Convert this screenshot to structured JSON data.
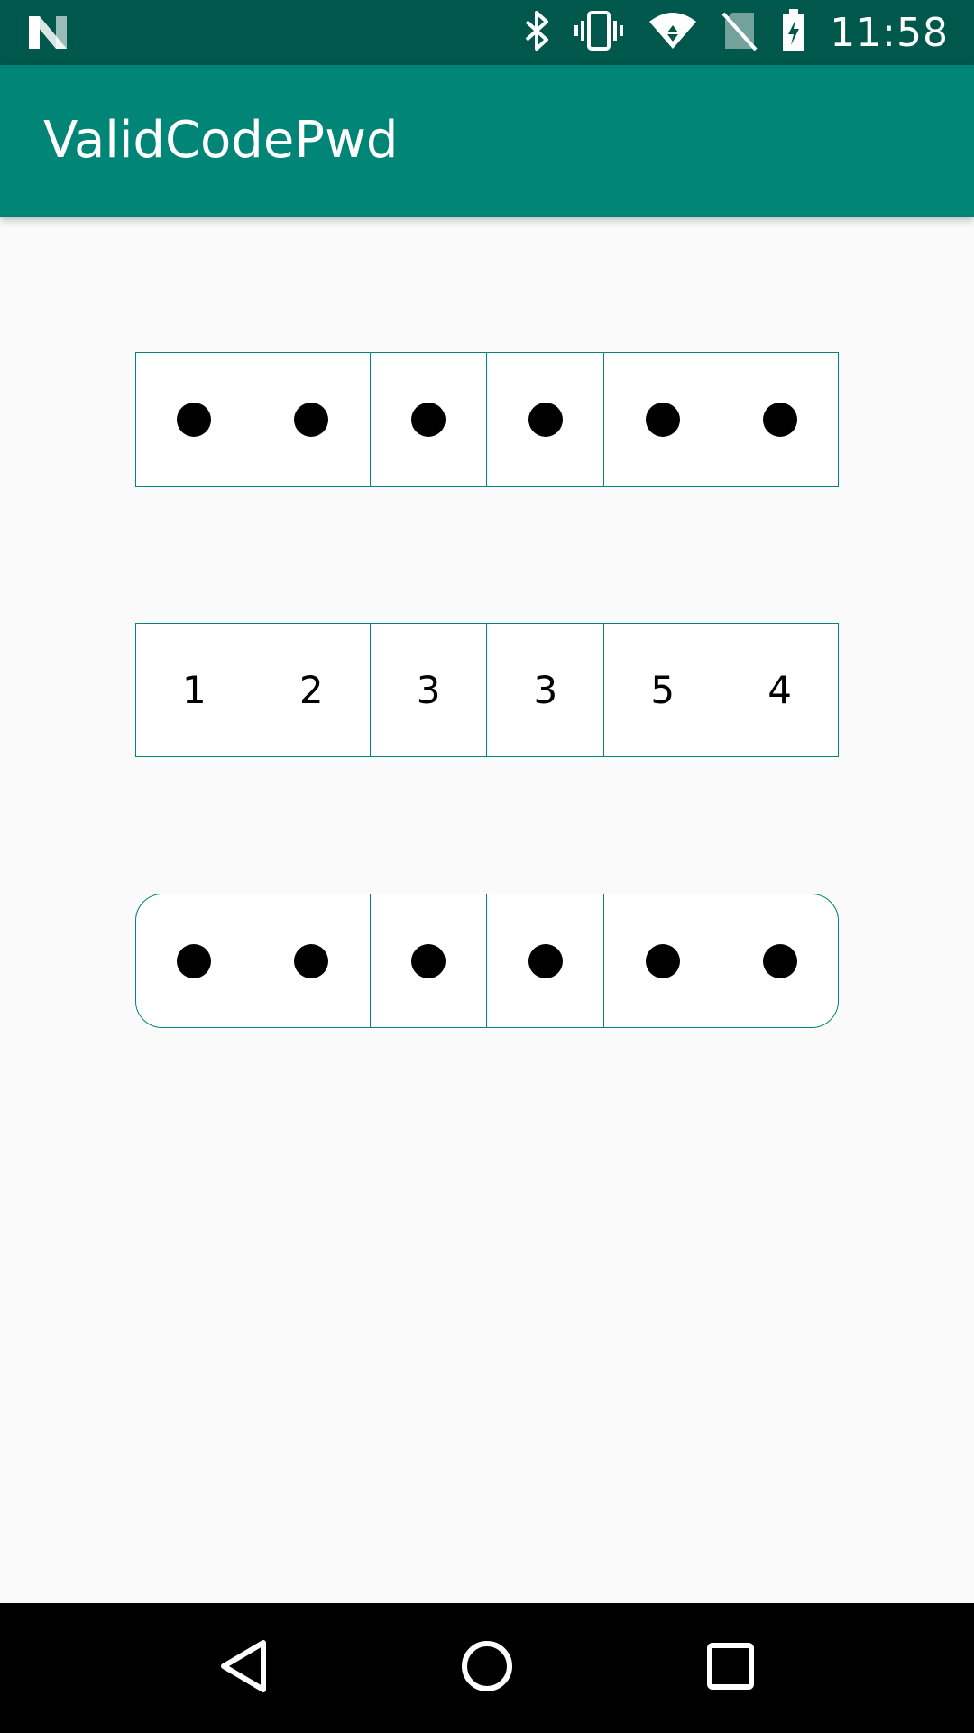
{
  "status_bar": {
    "time": "11:58",
    "icons": [
      "notification-n-icon",
      "bluetooth-icon",
      "vibrate-icon",
      "wifi-icon",
      "no-sim-icon",
      "battery-charging-icon"
    ],
    "background": "#00574b"
  },
  "app_bar": {
    "title": "ValidCodePwd",
    "background": "#008577"
  },
  "code_inputs": [
    {
      "style": "square-masked",
      "cells": [
        "●",
        "●",
        "●",
        "●",
        "●",
        "●"
      ]
    },
    {
      "style": "square-plain",
      "cells": [
        "1",
        "2",
        "3",
        "3",
        "5",
        "4"
      ]
    },
    {
      "style": "rounded-masked",
      "cells": [
        "●",
        "●",
        "●",
        "●",
        "●",
        "●"
      ]
    }
  ],
  "nav_bar": {
    "buttons": [
      "back-icon",
      "home-icon",
      "recents-icon"
    ]
  },
  "colors": {
    "accent": "#008577",
    "accent_dark": "#00574b",
    "page_background": "#fafafa",
    "cell_background": "#ffffff"
  }
}
